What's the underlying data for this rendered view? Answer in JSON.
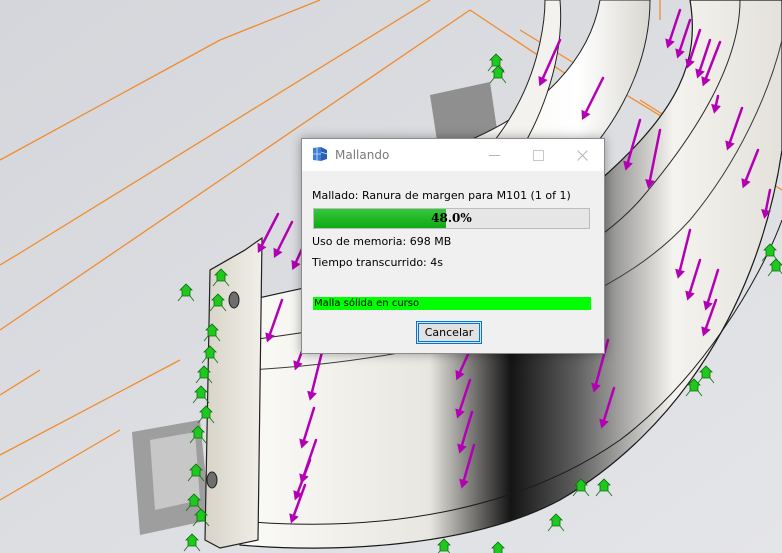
{
  "dialog": {
    "title": "Mallando",
    "task_label": "Mallado: Ranura de margen para M101 (1 of 1)",
    "progress": {
      "percent": 48.0,
      "text": "48.0%"
    },
    "memory_label": "Uso de memoria: 698 MB",
    "elapsed_label": "Tiempo transcurrido: 4s",
    "status_text": "Malla sólida en curso",
    "cancel_label": "Cancelar"
  },
  "icons": {
    "app": "mesh-app-icon",
    "minimize": "minimize-icon",
    "maximize": "maximize-icon",
    "close": "close-icon"
  },
  "colors": {
    "load_arrows": "#b400b4",
    "fixture_markers": "#1ec81e",
    "bounding_lines": "#f08c2d",
    "progress_fill": "#10a814",
    "status_bar": "#00ff00",
    "focus_border": "#0078d7"
  }
}
